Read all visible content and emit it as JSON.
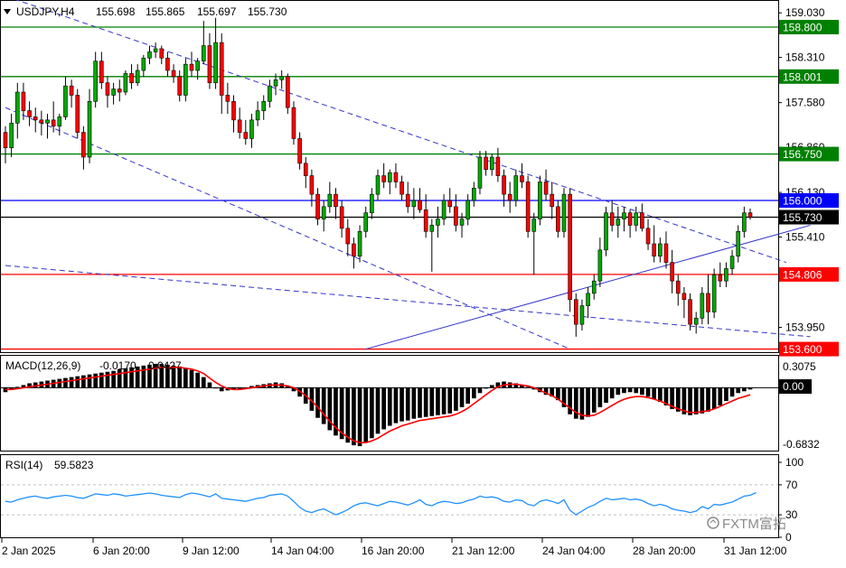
{
  "chart_data": {
    "type": "candlestick",
    "header": {
      "symbol": "USDJPY,H4",
      "open": "155.698",
      "high": "155.865",
      "low": "155.697",
      "close": "155.730"
    },
    "y_ticks": [
      "159.030",
      "158.310",
      "157.580",
      "156.860",
      "156.130",
      "155.410",
      "153.950"
    ],
    "ylim": [
      153.55,
      159.15
    ],
    "levels": [
      {
        "label": "158.800",
        "value": 158.8,
        "color": "#008000"
      },
      {
        "label": "158.001",
        "value": 158.001,
        "color": "#008000"
      },
      {
        "label": "156.750",
        "value": 156.75,
        "color": "#008000"
      },
      {
        "label": "156.000",
        "value": 156.0,
        "color": "#0000ff"
      },
      {
        "label": "155.730",
        "value": 155.73,
        "color": "#000000"
      },
      {
        "label": "154.806",
        "value": 154.806,
        "color": "#ff0000"
      },
      {
        "label": "153.600",
        "value": 153.6,
        "color": "#ff0000"
      }
    ],
    "candles": [
      [
        157.1,
        157.2,
        156.6,
        156.85
      ],
      [
        156.85,
        157.4,
        156.7,
        157.25
      ],
      [
        157.25,
        157.9,
        157.0,
        157.75
      ],
      [
        157.75,
        157.9,
        157.3,
        157.45
      ],
      [
        157.45,
        157.6,
        157.2,
        157.35
      ],
      [
        157.35,
        157.5,
        157.1,
        157.3
      ],
      [
        157.3,
        157.45,
        157.05,
        157.25
      ],
      [
        157.25,
        157.4,
        157.0,
        157.3
      ],
      [
        157.3,
        157.6,
        157.1,
        157.2
      ],
      [
        157.2,
        157.4,
        157.05,
        157.35
      ],
      [
        157.35,
        158.0,
        157.3,
        157.85
      ],
      [
        157.85,
        157.95,
        157.5,
        157.7
      ],
      [
        157.7,
        157.8,
        157.0,
        157.1
      ],
      [
        157.1,
        157.2,
        156.5,
        156.7
      ],
      [
        156.7,
        157.8,
        156.6,
        157.6
      ],
      [
        157.6,
        158.4,
        157.5,
        158.25
      ],
      [
        158.25,
        158.4,
        157.8,
        157.9
      ],
      [
        157.9,
        158.0,
        157.5,
        157.7
      ],
      [
        157.7,
        157.9,
        157.55,
        157.8
      ],
      [
        157.8,
        157.95,
        157.6,
        157.75
      ],
      [
        157.75,
        158.1,
        157.7,
        158.05
      ],
      [
        158.05,
        158.2,
        157.8,
        157.9
      ],
      [
        157.9,
        158.2,
        157.85,
        158.1
      ],
      [
        158.1,
        158.35,
        158.0,
        158.3
      ],
      [
        158.3,
        158.5,
        158.2,
        158.4
      ],
      [
        158.4,
        158.55,
        158.3,
        158.45
      ],
      [
        158.45,
        158.5,
        158.2,
        158.3
      ],
      [
        158.3,
        158.4,
        158.0,
        158.1
      ],
      [
        158.1,
        158.2,
        157.9,
        158.0
      ],
      [
        158.0,
        158.1,
        157.6,
        157.7
      ],
      [
        157.7,
        158.3,
        157.6,
        158.2
      ],
      [
        158.2,
        158.4,
        158.0,
        158.1
      ],
      [
        158.1,
        158.3,
        157.95,
        158.25
      ],
      [
        158.25,
        158.9,
        158.2,
        158.5
      ],
      [
        158.5,
        158.7,
        157.8,
        157.9
      ],
      [
        157.9,
        158.95,
        157.8,
        158.55
      ],
      [
        158.55,
        158.7,
        157.4,
        157.7
      ],
      [
        157.7,
        157.9,
        157.4,
        157.6
      ],
      [
        157.6,
        157.7,
        157.1,
        157.3
      ],
      [
        157.3,
        157.5,
        157.0,
        157.1
      ],
      [
        157.1,
        157.3,
        156.9,
        157.0
      ],
      [
        157.0,
        157.4,
        156.85,
        157.3
      ],
      [
        157.3,
        157.6,
        157.2,
        157.45
      ],
      [
        157.45,
        157.7,
        157.3,
        157.6
      ],
      [
        157.6,
        157.95,
        157.5,
        157.85
      ],
      [
        157.85,
        158.05,
        157.7,
        157.95
      ],
      [
        157.95,
        158.1,
        157.8,
        158.0
      ],
      [
        158.0,
        158.05,
        157.4,
        157.5
      ],
      [
        157.5,
        157.6,
        156.9,
        157.0
      ],
      [
        157.0,
        157.1,
        156.5,
        156.6
      ],
      [
        156.6,
        156.7,
        156.2,
        156.4
      ],
      [
        156.4,
        156.5,
        155.9,
        156.1
      ],
      [
        156.1,
        156.2,
        155.6,
        155.7
      ],
      [
        155.7,
        156.0,
        155.5,
        155.9
      ],
      [
        155.9,
        156.3,
        155.8,
        156.1
      ],
      [
        156.1,
        156.2,
        155.7,
        155.9
      ],
      [
        155.9,
        156.0,
        155.4,
        155.55
      ],
      [
        155.55,
        155.7,
        155.1,
        155.3
      ],
      [
        155.3,
        155.4,
        154.9,
        155.1
      ],
      [
        155.1,
        155.6,
        155.0,
        155.5
      ],
      [
        155.5,
        155.9,
        155.4,
        155.8
      ],
      [
        155.8,
        156.2,
        155.7,
        156.1
      ],
      [
        156.1,
        156.5,
        156.0,
        156.4
      ],
      [
        156.4,
        156.6,
        156.2,
        156.3
      ],
      [
        156.3,
        156.5,
        156.1,
        156.45
      ],
      [
        156.45,
        156.6,
        156.2,
        156.3
      ],
      [
        156.3,
        156.4,
        156.0,
        156.1
      ],
      [
        156.1,
        156.3,
        155.8,
        155.9
      ],
      [
        155.9,
        156.2,
        155.7,
        156.0
      ],
      [
        156.0,
        156.2,
        155.8,
        155.85
      ],
      [
        155.85,
        156.1,
        155.4,
        155.5
      ],
      [
        155.5,
        155.7,
        154.85,
        155.6
      ],
      [
        155.6,
        155.9,
        155.4,
        155.7
      ],
      [
        155.7,
        156.1,
        155.6,
        156.0
      ],
      [
        156.0,
        156.2,
        155.8,
        155.9
      ],
      [
        155.9,
        156.1,
        155.5,
        155.6
      ],
      [
        155.6,
        155.8,
        155.4,
        155.7
      ],
      [
        155.7,
        156.1,
        155.6,
        156.0
      ],
      [
        156.0,
        156.3,
        155.9,
        156.2
      ],
      [
        156.2,
        156.8,
        156.1,
        156.7
      ],
      [
        156.7,
        156.8,
        156.4,
        156.5
      ],
      [
        156.5,
        156.75,
        156.4,
        156.7
      ],
      [
        156.7,
        156.85,
        156.3,
        156.4
      ],
      [
        156.4,
        156.5,
        155.9,
        156.1
      ],
      [
        156.1,
        156.3,
        155.8,
        156.0
      ],
      [
        156.0,
        156.5,
        155.9,
        156.4
      ],
      [
        156.4,
        156.6,
        156.2,
        156.3
      ],
      [
        156.3,
        156.4,
        155.4,
        155.5
      ],
      [
        155.5,
        155.8,
        154.8,
        155.7
      ],
      [
        155.7,
        156.4,
        155.6,
        156.3
      ],
      [
        156.3,
        156.5,
        156.0,
        156.1
      ],
      [
        156.1,
        156.3,
        155.7,
        155.9
      ],
      [
        155.9,
        156.0,
        155.4,
        155.5
      ],
      [
        155.5,
        156.2,
        155.4,
        156.1
      ],
      [
        156.1,
        156.2,
        154.2,
        154.4
      ],
      [
        154.4,
        154.5,
        153.8,
        154.0
      ],
      [
        154.0,
        154.4,
        153.9,
        154.3
      ],
      [
        154.3,
        154.6,
        154.1,
        154.5
      ],
      [
        154.5,
        154.8,
        154.4,
        154.7
      ],
      [
        154.7,
        155.4,
        154.6,
        155.2
      ],
      [
        155.2,
        155.9,
        155.1,
        155.8
      ],
      [
        155.8,
        156.0,
        155.5,
        155.6
      ],
      [
        155.6,
        155.9,
        155.4,
        155.7
      ],
      [
        155.7,
        155.9,
        155.5,
        155.8
      ],
      [
        155.8,
        155.85,
        155.4,
        155.6
      ],
      [
        155.6,
        155.9,
        155.5,
        155.8
      ],
      [
        155.8,
        155.95,
        155.5,
        155.55
      ],
      [
        155.55,
        155.7,
        155.2,
        155.3
      ],
      [
        155.3,
        155.6,
        155.0,
        155.1
      ],
      [
        155.1,
        155.4,
        155.0,
        155.3
      ],
      [
        155.3,
        155.5,
        154.9,
        155.0
      ],
      [
        155.0,
        155.2,
        154.5,
        154.7
      ],
      [
        154.7,
        154.8,
        154.3,
        154.5
      ],
      [
        154.5,
        154.6,
        154.1,
        154.4
      ],
      [
        154.4,
        154.5,
        153.9,
        154.0
      ],
      [
        154.0,
        154.2,
        153.85,
        154.1
      ],
      [
        154.1,
        154.6,
        154.0,
        154.5
      ],
      [
        154.5,
        154.8,
        154.0,
        154.2
      ],
      [
        154.2,
        154.9,
        154.1,
        154.8
      ],
      [
        154.8,
        155.0,
        154.6,
        154.7
      ],
      [
        154.7,
        155.0,
        154.6,
        154.9
      ],
      [
        154.9,
        155.2,
        154.8,
        155.1
      ],
      [
        155.1,
        155.6,
        155.0,
        155.5
      ],
      [
        155.5,
        155.9,
        155.4,
        155.8
      ],
      [
        155.8,
        155.87,
        155.69,
        155.73
      ]
    ],
    "trendlines": [
      {
        "name": "upper-channel-line",
        "style": "dashed",
        "p1": [
          0.0,
          159.3
        ],
        "p2": [
          130.0,
          155.0
        ]
      },
      {
        "name": "lower-channel-line",
        "style": "dashed",
        "p1": [
          0.0,
          157.5
        ],
        "p2": [
          94.0,
          153.6
        ]
      },
      {
        "name": "long-dashed-line",
        "style": "dashed",
        "p1": [
          0.0,
          154.95
        ],
        "p2": [
          134.0,
          153.8
        ]
      },
      {
        "name": "ascending-solid-line",
        "style": "solid",
        "p1": [
          60.0,
          153.6
        ],
        "p2": [
          134.0,
          155.6
        ]
      }
    ],
    "macd": {
      "label": "MACD(12,26,9)",
      "main_value": "-0.0170",
      "signal_value": "0.0427",
      "tick_top": "0.3075",
      "tick_zero": "0.00",
      "tick_bottom": "-0.6832",
      "ylim": [
        -0.7,
        0.32
      ],
      "histogram": [
        -0.05,
        -0.02,
        0.01,
        0.03,
        0.05,
        0.06,
        0.07,
        0.08,
        0.09,
        0.1,
        0.11,
        0.12,
        0.13,
        0.14,
        0.15,
        0.16,
        0.17,
        0.18,
        0.19,
        0.21,
        0.22,
        0.23,
        0.24,
        0.25,
        0.26,
        0.27,
        0.27,
        0.26,
        0.25,
        0.24,
        0.22,
        0.2,
        0.17,
        0.12,
        0.06,
        0.0,
        -0.04,
        -0.03,
        -0.02,
        -0.01,
        0.0,
        0.02,
        0.03,
        0.04,
        0.05,
        0.06,
        0.05,
        0.02,
        -0.04,
        -0.1,
        -0.18,
        -0.26,
        -0.34,
        -0.41,
        -0.48,
        -0.54,
        -0.58,
        -0.62,
        -0.65,
        -0.66,
        -0.62,
        -0.57,
        -0.52,
        -0.47,
        -0.43,
        -0.4,
        -0.38,
        -0.37,
        -0.35,
        -0.34,
        -0.33,
        -0.32,
        -0.31,
        -0.3,
        -0.29,
        -0.26,
        -0.22,
        -0.18,
        -0.12,
        -0.06,
        -0.01,
        0.03,
        0.06,
        0.07,
        0.06,
        0.05,
        0.03,
        0.01,
        -0.02,
        -0.05,
        -0.08,
        -0.1,
        -0.14,
        -0.22,
        -0.3,
        -0.35,
        -0.36,
        -0.33,
        -0.28,
        -0.22,
        -0.17,
        -0.12,
        -0.08,
        -0.06,
        -0.05,
        -0.06,
        -0.08,
        -0.1,
        -0.13,
        -0.16,
        -0.2,
        -0.24,
        -0.27,
        -0.3,
        -0.31,
        -0.3,
        -0.29,
        -0.27,
        -0.24,
        -0.2,
        -0.15,
        -0.1,
        -0.06,
        -0.04,
        -0.02
      ],
      "signal": [
        -0.02,
        -0.02,
        -0.01,
        0.0,
        0.01,
        0.02,
        0.03,
        0.04,
        0.05,
        0.06,
        0.07,
        0.08,
        0.09,
        0.1,
        0.11,
        0.12,
        0.13,
        0.14,
        0.15,
        0.16,
        0.17,
        0.18,
        0.19,
        0.2,
        0.21,
        0.22,
        0.23,
        0.23,
        0.23,
        0.23,
        0.22,
        0.21,
        0.19,
        0.16,
        0.11,
        0.06,
        0.02,
        -0.01,
        -0.02,
        -0.02,
        -0.01,
        0.0,
        0.01,
        0.02,
        0.03,
        0.03,
        0.03,
        0.02,
        0.0,
        -0.04,
        -0.09,
        -0.15,
        -0.22,
        -0.3,
        -0.38,
        -0.45,
        -0.51,
        -0.56,
        -0.6,
        -0.62,
        -0.62,
        -0.6,
        -0.57,
        -0.53,
        -0.49,
        -0.46,
        -0.43,
        -0.41,
        -0.39,
        -0.37,
        -0.36,
        -0.35,
        -0.34,
        -0.33,
        -0.32,
        -0.3,
        -0.27,
        -0.23,
        -0.18,
        -0.13,
        -0.08,
        -0.03,
        0.01,
        0.03,
        0.04,
        0.04,
        0.03,
        0.02,
        0.0,
        -0.03,
        -0.06,
        -0.09,
        -0.13,
        -0.18,
        -0.23,
        -0.28,
        -0.31,
        -0.32,
        -0.31,
        -0.28,
        -0.24,
        -0.2,
        -0.16,
        -0.13,
        -0.11,
        -0.1,
        -0.1,
        -0.11,
        -0.13,
        -0.15,
        -0.18,
        -0.21,
        -0.24,
        -0.26,
        -0.28,
        -0.28,
        -0.27,
        -0.26,
        -0.24,
        -0.21,
        -0.18,
        -0.15,
        -0.12,
        -0.1,
        -0.08
      ]
    },
    "rsi": {
      "label": "RSI(14)",
      "value": "59.5823",
      "ticks": [
        "100",
        "70",
        "30",
        "0"
      ],
      "ylim": [
        0,
        100
      ],
      "levels": [
        70,
        30
      ],
      "values": [
        48,
        47,
        50,
        52,
        54,
        55,
        53,
        52,
        54,
        55,
        56,
        55,
        53,
        52,
        55,
        58,
        57,
        56,
        58,
        57,
        55,
        56,
        57,
        58,
        59,
        58,
        56,
        55,
        54,
        53,
        57,
        59,
        58,
        56,
        54,
        58,
        52,
        51,
        50,
        49,
        48,
        50,
        52,
        53,
        56,
        57,
        58,
        55,
        48,
        40,
        35,
        33,
        36,
        38,
        34,
        30,
        33,
        37,
        42,
        45,
        46,
        44,
        42,
        45,
        48,
        47,
        45,
        43,
        46,
        50,
        44,
        42,
        46,
        48,
        47,
        45,
        46,
        49,
        51,
        55,
        53,
        54,
        52,
        48,
        47,
        50,
        49,
        44,
        42,
        48,
        50,
        48,
        45,
        50,
        36,
        30,
        35,
        40,
        43,
        48,
        52,
        50,
        51,
        52,
        50,
        51,
        49,
        45,
        42,
        44,
        42,
        38,
        36,
        35,
        33,
        35,
        41,
        38,
        44,
        43,
        45,
        47,
        51,
        55,
        56,
        59.58
      ]
    },
    "x_ticks": [
      "2 Jan 2025",
      "6 Jan 20:00",
      "9 Jan 12:00",
      "14 Jan 04:00",
      "16 Jan 20:00",
      "21 Jan 12:00",
      "24 Jan 04:00",
      "28 Jan 20:00",
      "31 Jan 12:00"
    ],
    "x_tick_index": [
      0,
      21,
      41,
      61,
      81,
      101,
      121,
      141,
      161
    ]
  },
  "watermark": {
    "icon": "fxtm-logo-icon",
    "text": "FXTM富拓"
  },
  "colors": {
    "bull": "#00aa00",
    "bear": "#ff0000",
    "channel": "#3333cc",
    "macd_signal": "#ff0000",
    "rsi": "#1e90ff"
  }
}
